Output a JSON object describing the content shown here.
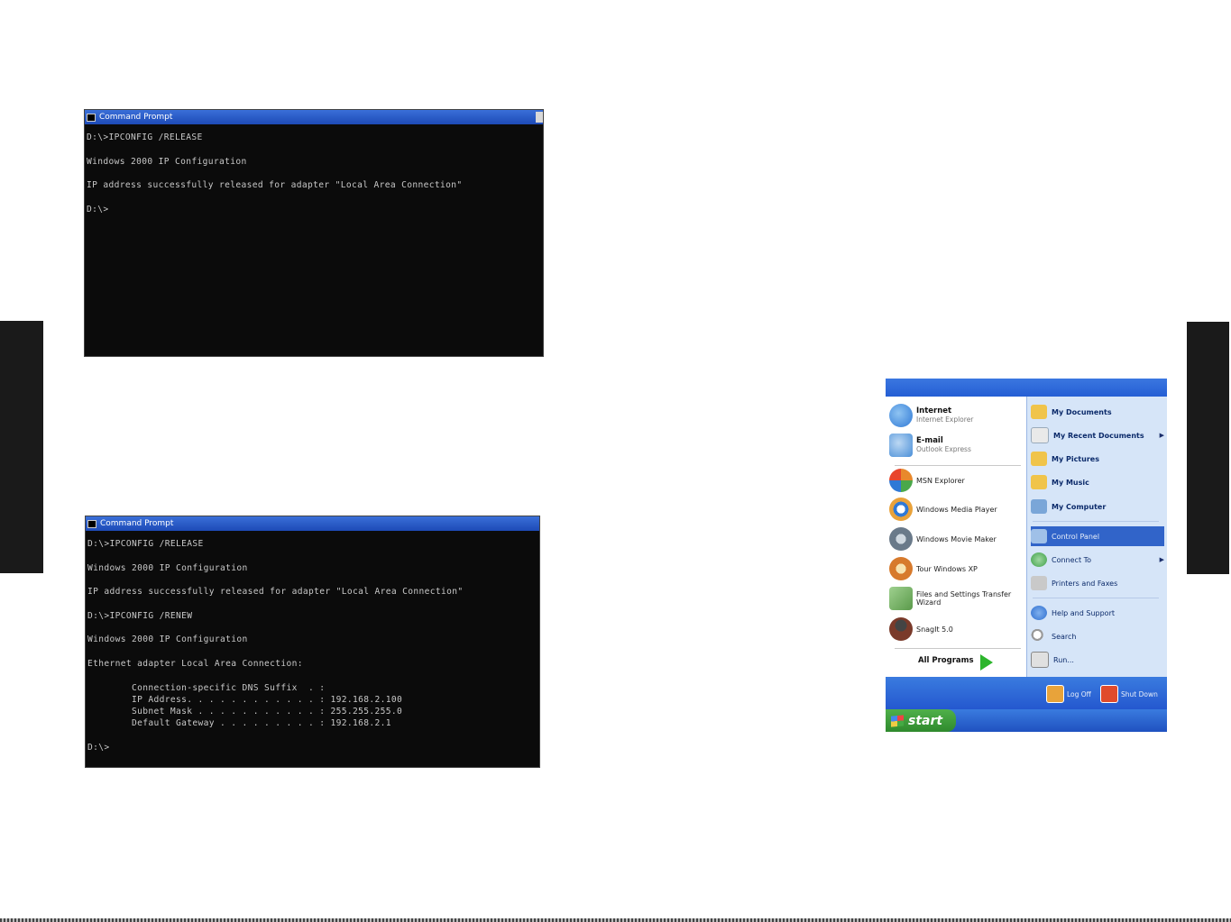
{
  "cmd_window_1": {
    "title": "Command Prompt",
    "lines": [
      "D:\\>IPCONFIG /RELEASE",
      "",
      "Windows 2000 IP Configuration",
      "",
      "IP address successfully released for adapter \"Local Area Connection\"",
      "",
      "D:\\>"
    ]
  },
  "cmd_window_2": {
    "title": "Command Prompt",
    "lines": [
      "D:\\>IPCONFIG /RELEASE",
      "",
      "Windows 2000 IP Configuration",
      "",
      "IP address successfully released for adapter \"Local Area Connection\"",
      "",
      "D:\\>IPCONFIG /RENEW",
      "",
      "Windows 2000 IP Configuration",
      "",
      "Ethernet adapter Local Area Connection:",
      "",
      "        Connection-specific DNS Suffix  . :",
      "        IP Address. . . . . . . . . . . . : 192.168.2.100",
      "        Subnet Mask . . . . . . . . . . . : 255.255.255.0",
      "        Default Gateway . . . . . . . . . : 192.168.2.1",
      "",
      "D:\\>"
    ]
  },
  "start_menu": {
    "left_items": [
      {
        "title": "Internet",
        "subtitle": "Internet Explorer",
        "icon": "internet-explorer-icon",
        "color": "#2f79d6"
      },
      {
        "title": "E-mail",
        "subtitle": "Outlook Express",
        "icon": "outlook-express-icon",
        "color": "#4a8fd8"
      },
      {
        "title": "MSN Explorer",
        "subtitle": "",
        "icon": "msn-butterfly-icon",
        "color": "#e8892c"
      },
      {
        "title": "Windows Media Player",
        "subtitle": "",
        "icon": "media-player-icon",
        "color": "#e9a23b"
      },
      {
        "title": "Windows Movie Maker",
        "subtitle": "",
        "icon": "movie-maker-icon",
        "color": "#6a7a8a"
      },
      {
        "title": "Tour Windows XP",
        "subtitle": "",
        "icon": "tour-xp-icon",
        "color": "#d77a2c"
      },
      {
        "title": "Files and Settings Transfer Wizard",
        "subtitle": "",
        "icon": "transfer-wizard-icon",
        "color": "#5a9a4a"
      },
      {
        "title": "SnagIt 5.0",
        "subtitle": "",
        "icon": "snagit-icon",
        "color": "#7a3a2a"
      }
    ],
    "all_programs": "All Programs",
    "right_items": [
      {
        "label": "My Documents",
        "bold": true,
        "icon": "folder-documents-icon",
        "color": "#f0c44a",
        "arrow": ""
      },
      {
        "label": "My Recent Documents",
        "bold": true,
        "icon": "recent-documents-icon",
        "color": "#e9e9e9",
        "arrow": "▶"
      },
      {
        "label": "My Pictures",
        "bold": true,
        "icon": "folder-pictures-icon",
        "color": "#f0c44a",
        "arrow": ""
      },
      {
        "label": "My Music",
        "bold": true,
        "icon": "folder-music-icon",
        "color": "#f0c44a",
        "arrow": ""
      },
      {
        "label": "My Computer",
        "bold": true,
        "icon": "computer-icon",
        "color": "#7aa6d8",
        "arrow": ""
      },
      {
        "label": "Control Panel",
        "bold": false,
        "icon": "control-panel-icon",
        "color": "#9fc0e8",
        "arrow": "",
        "selected": true
      },
      {
        "label": "Connect To",
        "bold": false,
        "icon": "connect-to-icon",
        "color": "#3fa04a",
        "arrow": "▶"
      },
      {
        "label": "Printers and Faxes",
        "bold": false,
        "icon": "printer-icon",
        "color": "#c9c9c9",
        "arrow": ""
      },
      {
        "label": "Help and Support",
        "bold": false,
        "icon": "help-icon",
        "color": "#2f6fd0",
        "arrow": ""
      },
      {
        "label": "Search",
        "bold": false,
        "icon": "search-icon",
        "color": "#dcdcdc",
        "arrow": ""
      },
      {
        "label": "Run...",
        "bold": false,
        "icon": "run-icon",
        "color": "#e0e0e0",
        "arrow": ""
      }
    ],
    "log_off": "Log Off",
    "shut_down": "Shut Down",
    "start_label": "start"
  }
}
